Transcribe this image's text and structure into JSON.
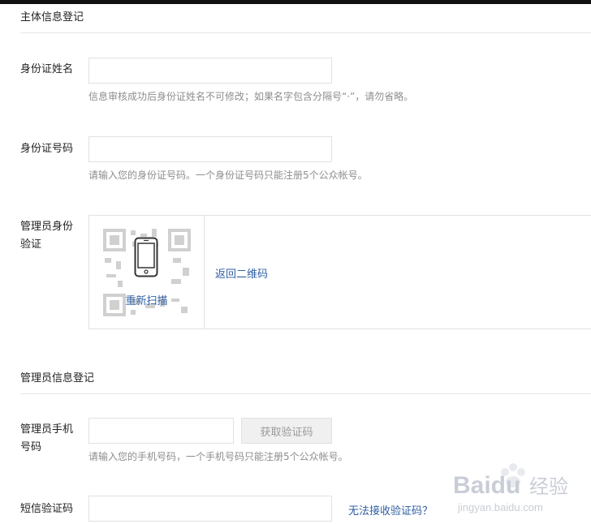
{
  "entity_section": {
    "title": "主体信息登记"
  },
  "id_name": {
    "label": "身份证姓名",
    "value": "",
    "hint": "信息审核成功后身份证姓名不可修改；如果名字包含分隔号“·”，请勿省略。"
  },
  "id_number": {
    "label": "身份证号码",
    "value": "",
    "hint": "请输入您的身份证号码。一个身份证号码只能注册5个公众帐号。"
  },
  "admin_verify": {
    "label": "管理员身份验证",
    "rescan_label": "重新扫描",
    "back_label": "返回二维码"
  },
  "admin_section": {
    "title": "管理员信息登记"
  },
  "admin_phone": {
    "label": "管理员手机号码",
    "value": "",
    "button_label": "获取验证码",
    "hint": "请输入您的手机号码，一个手机号码只能注册5个公众帐号。"
  },
  "sms_code": {
    "label": "短信验证码",
    "value": "",
    "help_link": "无法接收验证码？"
  },
  "watermark": {
    "brand": "Baidu",
    "sub": "经验",
    "url": "jingyan.baidu.com"
  },
  "colors": {
    "link": "#2f5fa3",
    "hint": "#8d8d8d",
    "border": "#e1e1e6",
    "divider": "#e7e7eb"
  }
}
